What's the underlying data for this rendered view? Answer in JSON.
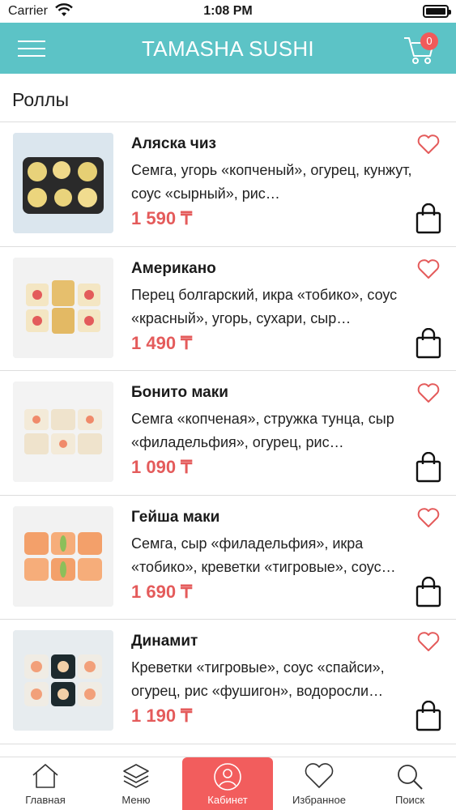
{
  "status_bar": {
    "carrier": "Carrier",
    "time": "1:08 PM"
  },
  "header": {
    "title": "TAMASHA SUSHI",
    "cart_count": "0"
  },
  "section": {
    "title": "Роллы"
  },
  "items": [
    {
      "name": "Аляска чиз",
      "desc": "Семга, угорь «копченый», огурец, кунжут, соус «сырный», рис…",
      "price": "1 590 ₸"
    },
    {
      "name": "Американо",
      "desc": "Перец болгарский, икра «тобико», соус «красный», угорь, сухари, сыр…",
      "price": "1 490 ₸"
    },
    {
      "name": "Бонито маки",
      "desc": "Семга «копченая», стружка тунца, сыр «филадельфия», огурец, рис…",
      "price": "1 090 ₸"
    },
    {
      "name": "Гейша маки",
      "desc": "Семга, сыр «филадельфия», икра «тобико», креветки «тигровые», соус…",
      "price": "1 690 ₸"
    },
    {
      "name": "Динамит",
      "desc": "Креветки «тигровые», соус «спайси», огурец, рис «фушигон», водоросли…",
      "price": "1 190 ₸"
    }
  ],
  "tabbar": {
    "home": "Главная",
    "menu": "Меню",
    "cabinet": "Кабинет",
    "favorites": "Избранное",
    "search": "Поиск"
  },
  "colors": {
    "header": "#5cc3c6",
    "accent": "#f25d5d",
    "price": "#e45b5b"
  }
}
